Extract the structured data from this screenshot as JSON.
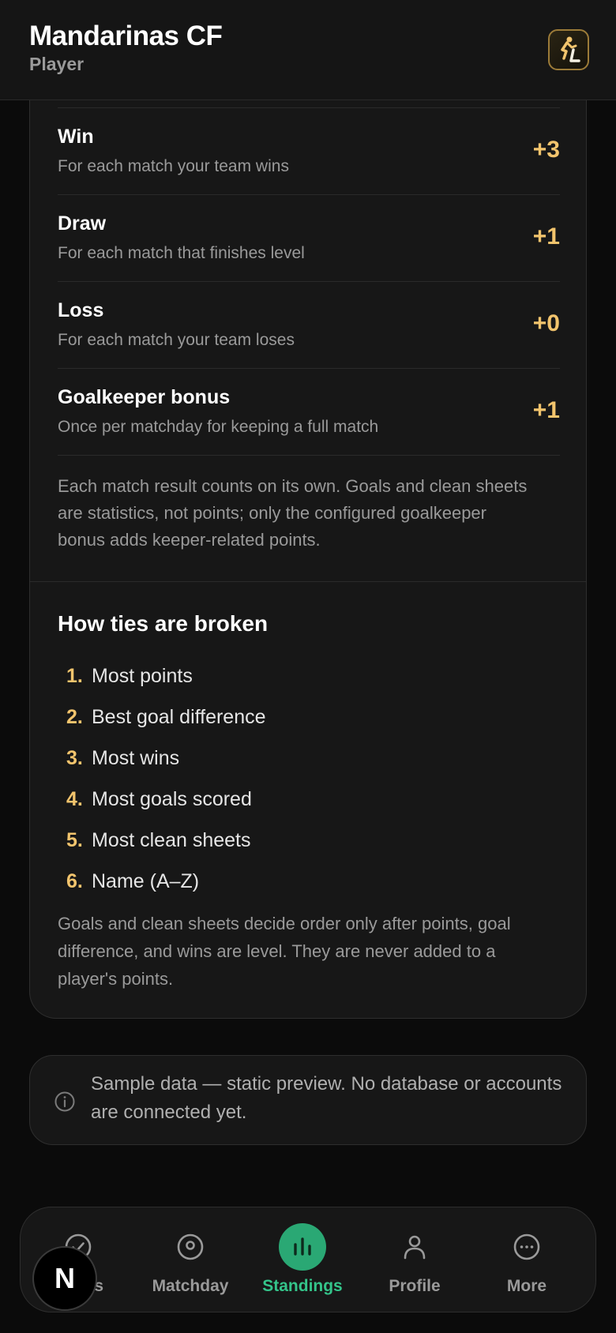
{
  "header": {
    "title": "Mandarinas CF",
    "subtitle": "Player"
  },
  "scoring_rows": [
    {
      "title": "Win",
      "desc": "For each match your team wins",
      "value": "+3"
    },
    {
      "title": "Draw",
      "desc": "For each match that finishes level",
      "value": "+1"
    },
    {
      "title": "Loss",
      "desc": "For each match your team loses",
      "value": "+0"
    },
    {
      "title": "Goalkeeper bonus",
      "desc": "Once per matchday for keeping a full match",
      "value": "+1"
    }
  ],
  "scoring_note": "Each match result counts on its own. Goals and clean sheets are statistics, not points; only the configured goalkeeper bonus adds keeper-related points.",
  "ties": {
    "title": "How ties are broken",
    "items": [
      {
        "num": "1.",
        "label": "Most points"
      },
      {
        "num": "2.",
        "label": "Best goal difference"
      },
      {
        "num": "3.",
        "label": "Most wins"
      },
      {
        "num": "4.",
        "label": "Most goals scored"
      },
      {
        "num": "5.",
        "label": "Most clean sheets"
      },
      {
        "num": "6.",
        "label": "Name (A–Z)"
      }
    ],
    "note": "Goals and clean sheets decide order only after points, goal difference, and wins are level. They are never added to a player's points."
  },
  "info_banner": "Sample data — static preview. No database or accounts are connected yet.",
  "nav": [
    {
      "label": "Status",
      "icon": "check-circle-icon"
    },
    {
      "label": "Matchday",
      "icon": "ball-icon"
    },
    {
      "label": "Standings",
      "icon": "bar-chart-icon",
      "active": true
    },
    {
      "label": "Profile",
      "icon": "user-icon"
    },
    {
      "label": "More",
      "icon": "more-icon"
    }
  ],
  "badge": "N",
  "colors": {
    "accent": "#f2c46d",
    "active": "#2aa874",
    "active_text": "#34c48a"
  }
}
